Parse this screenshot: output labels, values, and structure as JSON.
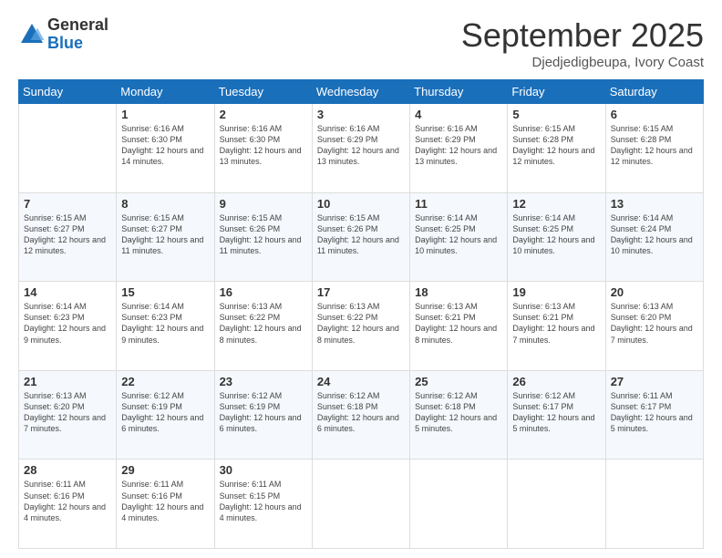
{
  "logo": {
    "general": "General",
    "blue": "Blue"
  },
  "title": {
    "month_year": "September 2025",
    "location": "Djedjedigbeupa, Ivory Coast"
  },
  "days_of_week": [
    "Sunday",
    "Monday",
    "Tuesday",
    "Wednesday",
    "Thursday",
    "Friday",
    "Saturday"
  ],
  "weeks": [
    [
      {
        "day": "",
        "info": ""
      },
      {
        "day": "1",
        "info": "Sunrise: 6:16 AM\nSunset: 6:30 PM\nDaylight: 12 hours\nand 14 minutes."
      },
      {
        "day": "2",
        "info": "Sunrise: 6:16 AM\nSunset: 6:30 PM\nDaylight: 12 hours\nand 13 minutes."
      },
      {
        "day": "3",
        "info": "Sunrise: 6:16 AM\nSunset: 6:29 PM\nDaylight: 12 hours\nand 13 minutes."
      },
      {
        "day": "4",
        "info": "Sunrise: 6:16 AM\nSunset: 6:29 PM\nDaylight: 12 hours\nand 13 minutes."
      },
      {
        "day": "5",
        "info": "Sunrise: 6:15 AM\nSunset: 6:28 PM\nDaylight: 12 hours\nand 12 minutes."
      },
      {
        "day": "6",
        "info": "Sunrise: 6:15 AM\nSunset: 6:28 PM\nDaylight: 12 hours\nand 12 minutes."
      }
    ],
    [
      {
        "day": "7",
        "info": "Sunrise: 6:15 AM\nSunset: 6:27 PM\nDaylight: 12 hours\nand 12 minutes."
      },
      {
        "day": "8",
        "info": "Sunrise: 6:15 AM\nSunset: 6:27 PM\nDaylight: 12 hours\nand 11 minutes."
      },
      {
        "day": "9",
        "info": "Sunrise: 6:15 AM\nSunset: 6:26 PM\nDaylight: 12 hours\nand 11 minutes."
      },
      {
        "day": "10",
        "info": "Sunrise: 6:15 AM\nSunset: 6:26 PM\nDaylight: 12 hours\nand 11 minutes."
      },
      {
        "day": "11",
        "info": "Sunrise: 6:14 AM\nSunset: 6:25 PM\nDaylight: 12 hours\nand 10 minutes."
      },
      {
        "day": "12",
        "info": "Sunrise: 6:14 AM\nSunset: 6:25 PM\nDaylight: 12 hours\nand 10 minutes."
      },
      {
        "day": "13",
        "info": "Sunrise: 6:14 AM\nSunset: 6:24 PM\nDaylight: 12 hours\nand 10 minutes."
      }
    ],
    [
      {
        "day": "14",
        "info": "Sunrise: 6:14 AM\nSunset: 6:23 PM\nDaylight: 12 hours\nand 9 minutes."
      },
      {
        "day": "15",
        "info": "Sunrise: 6:14 AM\nSunset: 6:23 PM\nDaylight: 12 hours\nand 9 minutes."
      },
      {
        "day": "16",
        "info": "Sunrise: 6:13 AM\nSunset: 6:22 PM\nDaylight: 12 hours\nand 8 minutes."
      },
      {
        "day": "17",
        "info": "Sunrise: 6:13 AM\nSunset: 6:22 PM\nDaylight: 12 hours\nand 8 minutes."
      },
      {
        "day": "18",
        "info": "Sunrise: 6:13 AM\nSunset: 6:21 PM\nDaylight: 12 hours\nand 8 minutes."
      },
      {
        "day": "19",
        "info": "Sunrise: 6:13 AM\nSunset: 6:21 PM\nDaylight: 12 hours\nand 7 minutes."
      },
      {
        "day": "20",
        "info": "Sunrise: 6:13 AM\nSunset: 6:20 PM\nDaylight: 12 hours\nand 7 minutes."
      }
    ],
    [
      {
        "day": "21",
        "info": "Sunrise: 6:13 AM\nSunset: 6:20 PM\nDaylight: 12 hours\nand 7 minutes."
      },
      {
        "day": "22",
        "info": "Sunrise: 6:12 AM\nSunset: 6:19 PM\nDaylight: 12 hours\nand 6 minutes."
      },
      {
        "day": "23",
        "info": "Sunrise: 6:12 AM\nSunset: 6:19 PM\nDaylight: 12 hours\nand 6 minutes."
      },
      {
        "day": "24",
        "info": "Sunrise: 6:12 AM\nSunset: 6:18 PM\nDaylight: 12 hours\nand 6 minutes."
      },
      {
        "day": "25",
        "info": "Sunrise: 6:12 AM\nSunset: 6:18 PM\nDaylight: 12 hours\nand 5 minutes."
      },
      {
        "day": "26",
        "info": "Sunrise: 6:12 AM\nSunset: 6:17 PM\nDaylight: 12 hours\nand 5 minutes."
      },
      {
        "day": "27",
        "info": "Sunrise: 6:11 AM\nSunset: 6:17 PM\nDaylight: 12 hours\nand 5 minutes."
      }
    ],
    [
      {
        "day": "28",
        "info": "Sunrise: 6:11 AM\nSunset: 6:16 PM\nDaylight: 12 hours\nand 4 minutes."
      },
      {
        "day": "29",
        "info": "Sunrise: 6:11 AM\nSunset: 6:16 PM\nDaylight: 12 hours\nand 4 minutes."
      },
      {
        "day": "30",
        "info": "Sunrise: 6:11 AM\nSunset: 6:15 PM\nDaylight: 12 hours\nand 4 minutes."
      },
      {
        "day": "",
        "info": ""
      },
      {
        "day": "",
        "info": ""
      },
      {
        "day": "",
        "info": ""
      },
      {
        "day": "",
        "info": ""
      }
    ]
  ]
}
